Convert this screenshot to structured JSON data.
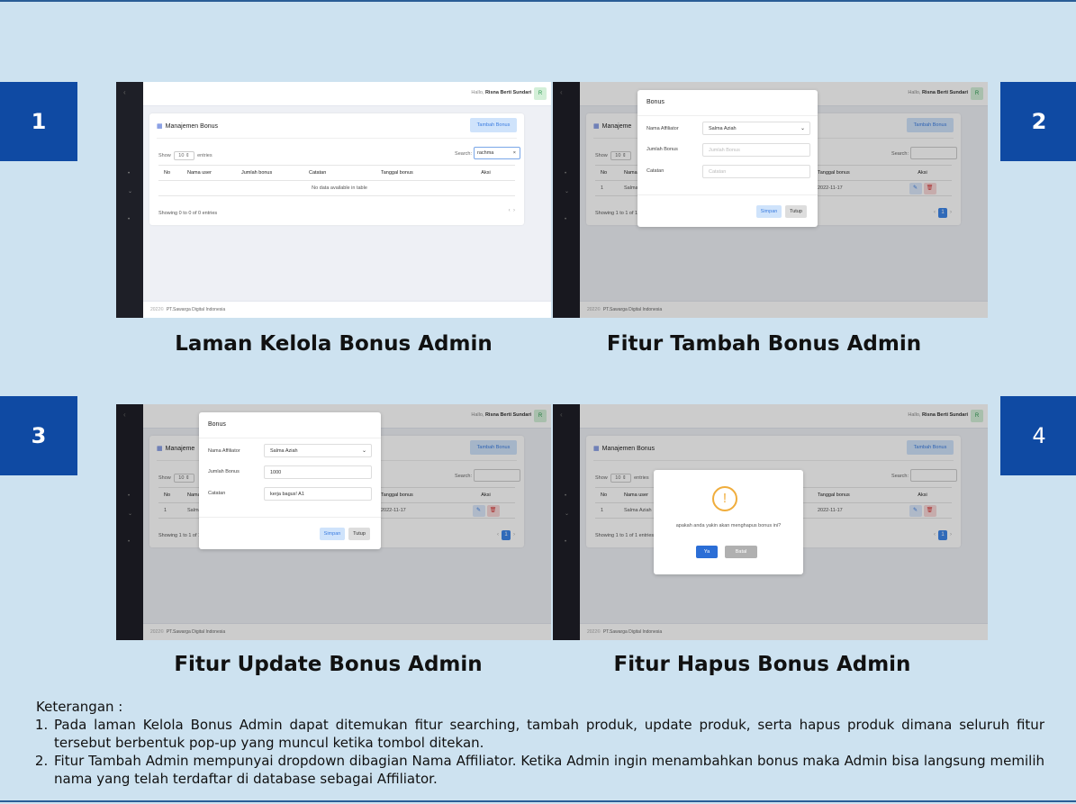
{
  "markers": [
    "1",
    "2",
    "3",
    "4"
  ],
  "captions": [
    "Laman Kelola Bonus Admin",
    "Fitur Tambah Bonus Admin",
    "Fitur Update Bonus Admin",
    "Fitur Hapus Bonus Admin"
  ],
  "app": {
    "hello": "Hallo,",
    "user": "Risna Berti Sundari",
    "avatar": "R",
    "title": "Manajemen Bonus",
    "title_short": "Manajeme",
    "add_button": "Tambah Bonus",
    "show": "Show",
    "entries": "entries",
    "per_page": "10",
    "search_label": "Search:",
    "search_value": "rachma",
    "columns": [
      "No",
      "Nama user",
      "Jumlah bonus",
      "Catatan",
      "Tanggal bonus",
      "Aksi"
    ],
    "empty": "No data available in table",
    "row": {
      "no": "1",
      "name": "Salma Aziah",
      "date": "2022-11-17"
    },
    "info_empty": "Showing 0 to 0 of 0 entries",
    "info_one": "Showing 1 to 1 of 1 entries",
    "page": "1",
    "footer_year": "2022©",
    "footer_company": "PT.Sawarga Digital Indonesia"
  },
  "modal": {
    "title": "Bonus",
    "label_affiliator": "Nama Affiliator",
    "label_jumlah": "Jumlah Bonus",
    "label_catatan": "Catatan",
    "affiliator_value": "Salma Aziah",
    "jumlah_placeholder": "Jumlah Bonus",
    "catatan_placeholder": "Catatan",
    "jumlah_value": "1000",
    "catatan_value": "kerja bagus! A1",
    "simpan": "Simpan",
    "tutup": "Tutup"
  },
  "delete_dialog": {
    "icon": "!",
    "message": "apakah anda yakin akan menghapus bonus ini?",
    "yes": "Ya",
    "cancel": "Batal"
  },
  "keterangan": {
    "heading": "Keterangan :",
    "items": [
      "Pada laman Kelola Bonus Admin dapat ditemukan fitur searching, tambah produk, update produk, serta hapus produk dimana seluruh fitur tersebut berbentuk pop-up yang muncul ketika tombol ditekan.",
      "Fitur Tambah Admin mempunyai dropdown dibagian Nama Affiliator. Ketika Admin ingin menambahkan bonus maka Admin bisa langsung memilih nama yang telah terdaftar di database sebagai Affiliator."
    ]
  }
}
